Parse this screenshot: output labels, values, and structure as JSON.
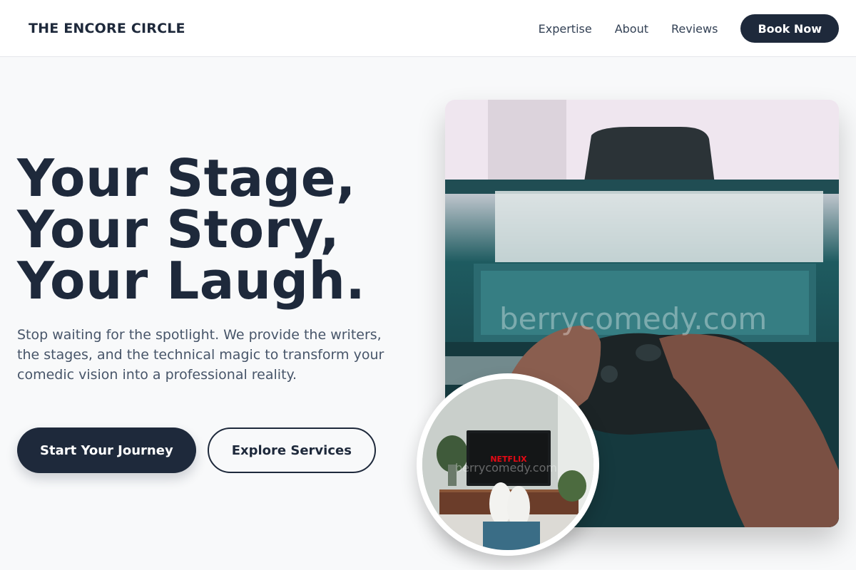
{
  "brand": {
    "name": "THE ENCORE CIRCLE"
  },
  "nav": {
    "links": [
      "Expertise",
      "About",
      "Reviews"
    ],
    "cta_label": "Book Now"
  },
  "hero": {
    "headline_lines": [
      "Your Stage,",
      "Your Story,",
      "Your Laugh."
    ],
    "subtext": "Stop waiting for the spotlight. We provide the writers, the stages, and the technical magic to transform your comedic vision into a professional reality.",
    "primary_cta": "Start Your Journey",
    "secondary_cta": "Explore Services"
  },
  "images": {
    "main_watermark": "berrycomedy.com",
    "circle_watermark": "berrycomedy.com",
    "tv_brand": "NETFLIX"
  },
  "colors": {
    "primary": "#1e293b",
    "background": "#f8f9fa",
    "text_muted": "#475569"
  }
}
